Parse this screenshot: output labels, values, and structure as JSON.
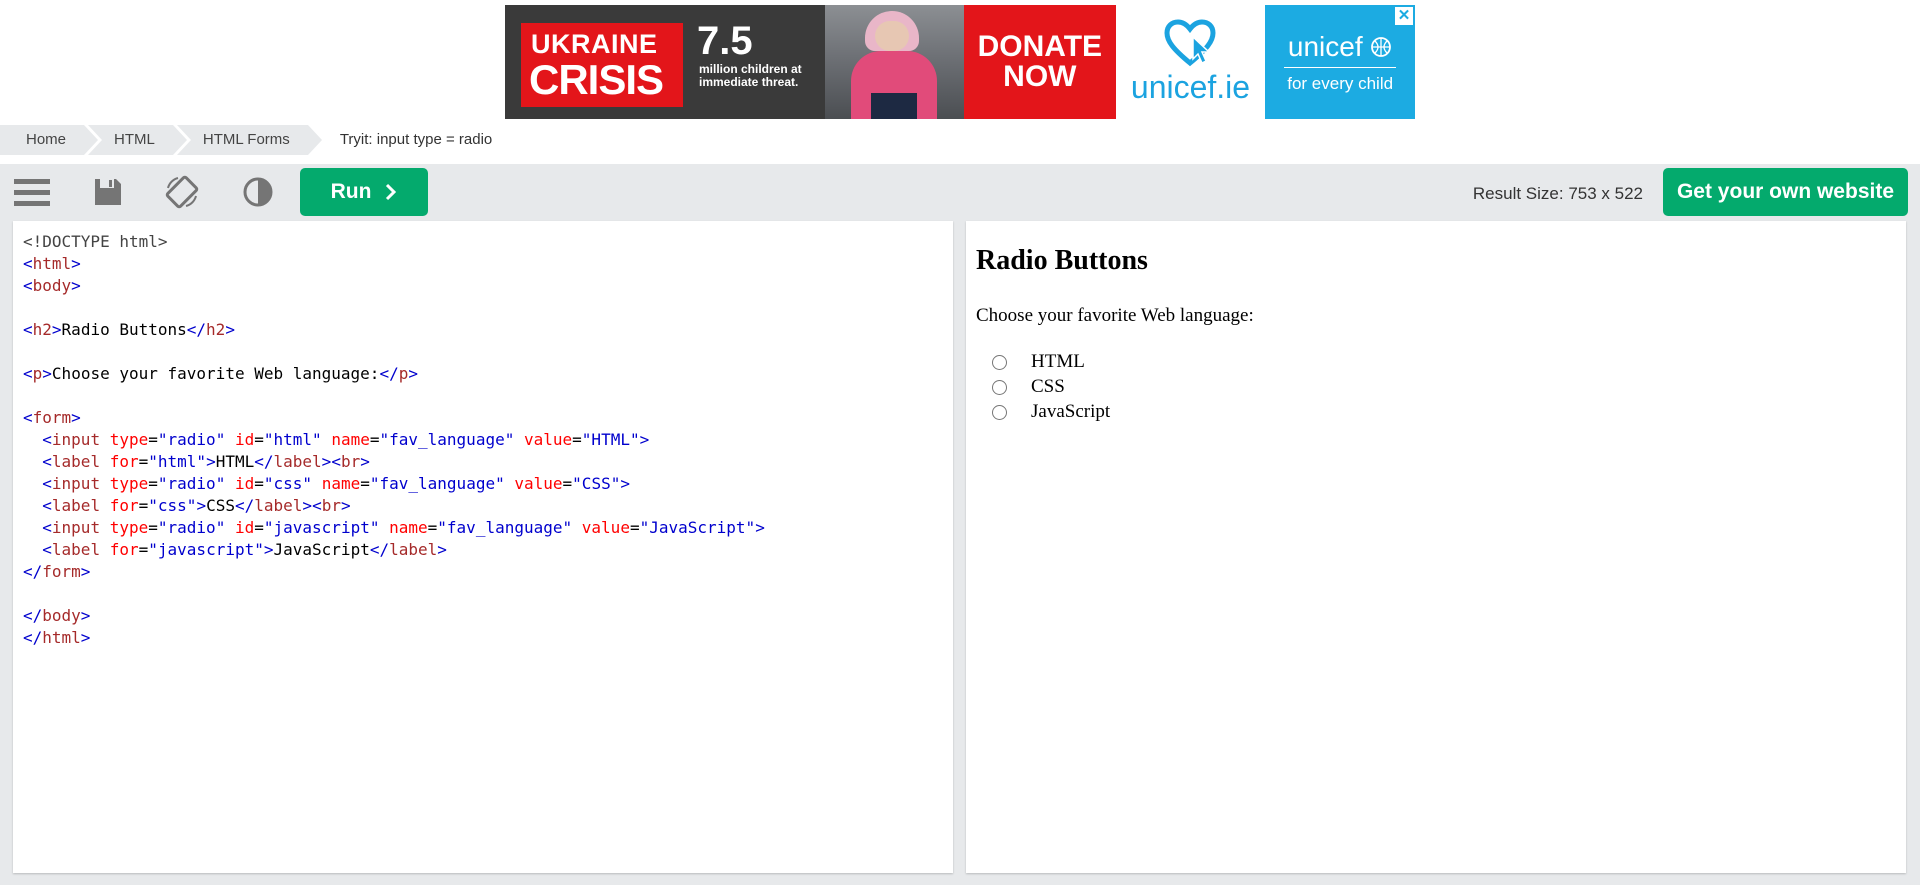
{
  "ad": {
    "headline_1": "UKRAINE",
    "headline_2": "CRISIS",
    "number": "7.5",
    "subtext": "million children at immediate threat.",
    "donate_1": "DONATE",
    "donate_2": "NOW",
    "domain": "unicef.ie",
    "brand": "unicef",
    "tagline": "for every child",
    "close": "✕"
  },
  "breadcrumb": {
    "items": [
      "Home",
      "HTML",
      "HTML Forms"
    ],
    "current": "Tryit: input type = radio"
  },
  "toolbar": {
    "run_label": "Run",
    "result_size": "Result Size: 753 x 522",
    "own_website_label": "Get your own website"
  },
  "result": {
    "heading": "Radio Buttons",
    "question": "Choose your favorite Web language:",
    "options": [
      "HTML",
      "CSS",
      "JavaScript"
    ]
  },
  "code": {
    "doctype": "<!DOCTYPE html>",
    "lt": "<",
    "gt": ">",
    "ltslash": "</",
    "eq": "=",
    "tag_html": "html",
    "tag_body": "body",
    "tag_h2": "h2",
    "tag_p": "p",
    "tag_form": "form",
    "tag_input": "input",
    "tag_label": "label",
    "tag_br": "br",
    "attr_type": "type",
    "attr_id": "id",
    "attr_name": "name",
    "attr_value": "value",
    "attr_for": "for",
    "v_radio": "\"radio\"",
    "v_html": "\"html\"",
    "v_css": "\"css\"",
    "v_js": "\"javascript\"",
    "v_fav": "\"fav_language\"",
    "v_HTML": "\"HTML\"",
    "v_CSS": "\"CSS\"",
    "v_JS": "\"JavaScript\"",
    "h2_text": "Radio Buttons",
    "p_text": "Choose your favorite Web language:",
    "lbl_HTML": "HTML",
    "lbl_CSS": "CSS",
    "lbl_JS": "JavaScript"
  }
}
